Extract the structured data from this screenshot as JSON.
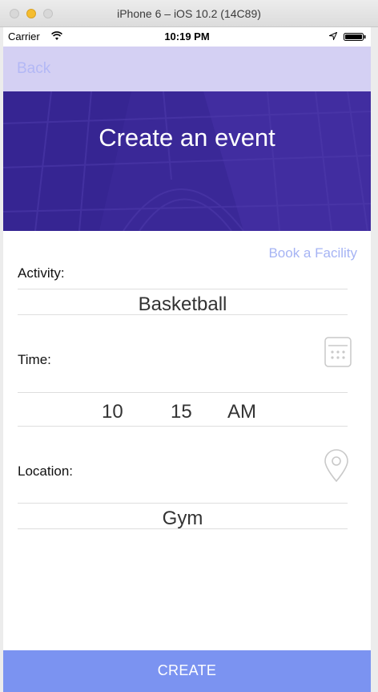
{
  "window": {
    "title": "iPhone 6 – iOS 10.2 (14C89)"
  },
  "status_bar": {
    "carrier": "Carrier",
    "time": "10:19 PM",
    "icons": [
      "wifi-icon",
      "location-arrow-icon",
      "battery-icon"
    ]
  },
  "nav": {
    "back_label": "Back"
  },
  "hero": {
    "title": "Create an event"
  },
  "form": {
    "book_facility_label": "Book a Facility",
    "activity": {
      "label": "Activity:",
      "value": "Basketball"
    },
    "time": {
      "label": "Time:",
      "hour": "10",
      "minute": "15",
      "period": "AM",
      "icon": "calendar-icon"
    },
    "location": {
      "label": "Location:",
      "value": "Gym",
      "icon": "map-pin-icon"
    }
  },
  "create_button": {
    "label": "CREATE"
  },
  "colors": {
    "nav_bg": "#d4d0f3",
    "hero_bg": "#3f2aa0",
    "accent_link": "#a6b4f4",
    "create_bg": "#7b93f1"
  }
}
